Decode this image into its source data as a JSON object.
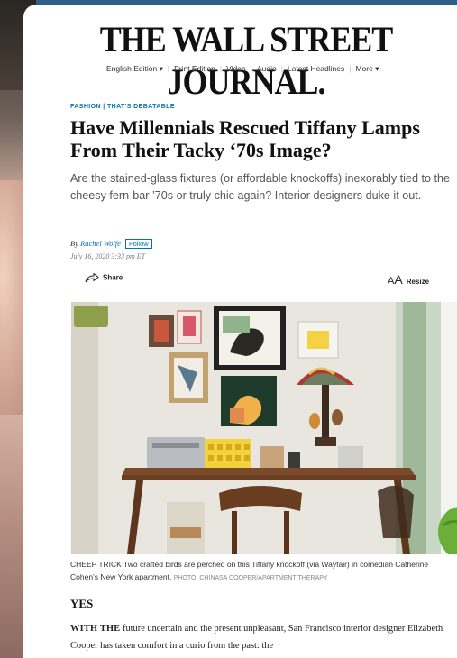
{
  "masthead": "THE WALL STREET JOURNAL.",
  "nav": {
    "items": [
      "English Edition ▾",
      "Print Edition",
      "Video",
      "Audio",
      "Latest Headlines",
      "More ▾"
    ]
  },
  "article": {
    "kicker": "FASHION  |  THAT'S DEBATABLE",
    "headline": "Have Millennials Rescued Tiffany Lamps From Their Tacky ‘70s Image?",
    "dek": "Are the stained-glass fixtures (or affordable knockoffs) inexorably tied to the cheesy fern-bar ’70s or truly chic again? Interior designers duke it out.",
    "byline_prefix": "By",
    "author": "Rachel Wolfe",
    "follow_label": "Follow",
    "date": "July 16, 2020 3:33 pm ET",
    "share_label": "Share",
    "resize_label": "Resize",
    "caption": "CHEEP TRICK Two crafted birds are perched on this Tiffany knockoff (via Wayfair) in comedian Catherine Cohen’s New York apartment.",
    "credit": "PHOTO: CHINASA COOPER/APARTMENT THERAPY",
    "section_heading": "YES",
    "body_lead": "WITH THE",
    "body_text": " future uncertain and the present unpleasant, San Francisco interior designer Elizabeth Cooper has taken comfort in a curio from the past: the"
  },
  "colors": {
    "accent": "#0274b6",
    "frame": "#2f5f86"
  }
}
